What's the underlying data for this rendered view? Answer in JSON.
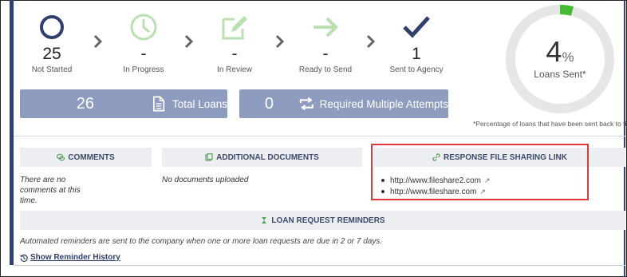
{
  "statuses": [
    {
      "count": "25",
      "label": "Not Started",
      "icon": "circle-icon",
      "color": "#2f3f6e"
    },
    {
      "count": "-",
      "label": "In Progress",
      "icon": "clock-icon",
      "color": "#b8e0b0"
    },
    {
      "count": "-",
      "label": "In Review",
      "icon": "edit-icon",
      "color": "#b8e0b0"
    },
    {
      "count": "-",
      "label": "Ready to Send",
      "icon": "arrow-right-icon",
      "color": "#b8e0b0"
    },
    {
      "count": "1",
      "label": "Sent to Agency",
      "icon": "checkmark-icon",
      "color": "#2f3f6e"
    }
  ],
  "summary": {
    "total_loans_count": "26",
    "total_loans_label": "Total Loans",
    "attempts_count": "0",
    "attempts_label": "Required Multiple Attempts"
  },
  "donut": {
    "percent": "4",
    "percent_symbol": "%",
    "label": "Loans Sent*",
    "fraction": 0.04,
    "track_color": "#e6e6e6",
    "fill_color": "#44bb33"
  },
  "footnote": "*Percentage of loans that have been sent back to the",
  "sections": {
    "comments": {
      "title": "COMMENTS",
      "body": "There are no comments at this time."
    },
    "documents": {
      "title": "ADDITIONAL DOCUMENTS",
      "body": "No documents uploaded"
    },
    "links": {
      "title": "RESPONSE FILE SHARING LINK",
      "items": [
        "http://www.fileshare2.com",
        "http://www.fileshare.com"
      ]
    }
  },
  "reminders": {
    "title": "LOAN REQUEST REMINDERS",
    "text": "Automated reminders are sent to the company when one or more loan requests are due in 2 or 7 days.",
    "history_link": "Show Reminder History"
  },
  "colors": {
    "accent": "#2f3f6e",
    "box": "#8e9cbf",
    "highlight": "#e03a3a"
  }
}
